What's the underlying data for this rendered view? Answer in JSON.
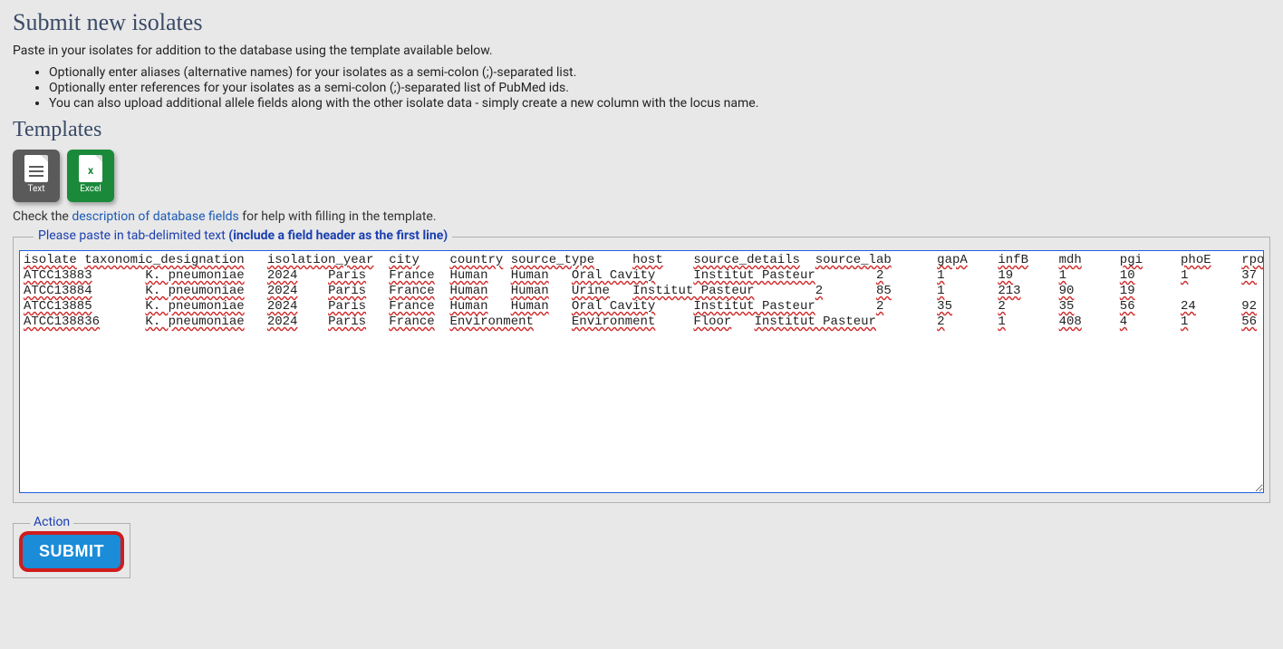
{
  "header": {
    "title": "Submit new isolates",
    "intro": "Paste in your isolates for addition to the database using the template available below.",
    "instructions": [
      "Optionally enter aliases (alternative names) for your isolates as a semi-colon (;)-separated list.",
      "Optionally enter references for your isolates as a semi-colon (;)-separated list of PubMed ids.",
      "You can also upload additional allele fields along with the other isolate data - simply create a new column with the locus name."
    ]
  },
  "templates": {
    "title": "Templates",
    "text_label": "Text",
    "excel_label": "Excel",
    "check_prefix": "Check the ",
    "check_link": "description of database fields",
    "check_suffix": " for help with filling in the template."
  },
  "paste_box": {
    "legend_plain": "Please paste in tab-delimited text ",
    "legend_bold": "(include a field header as the first line)",
    "value": "isolate\ttaxonomic_designation\tisolation_year\tcity\tcountry\tsource_type\thost\tsource_details\tsource_lab\tgapA\tinfB\tmdh\tpgi\tphoE\trpoB\ttonB\nATCC13883\tK. pneumoniae\t2024\tParis\tFrance\tHuman\tHuman\tOral Cavity\tInstitut Pasteur\t2\t1\t19\t1\t10\t1\t37\nATCC13884\tK. pneumoniae\t2024\tParis\tFrance\tHuman\tHuman\tUrine\tInstitut Pasteur\t2\t85\t1\t213\t90\t19\nATCC13885\tK. pneumoniae\t2024\tParis\tFrance\tHuman\tHuman\tOral Cavity\tInstitut Pasteur\t2\t35\t2\t35\t56\t24\t92\nATCC138836\tK. pneumoniae\t2024\tParis\tFrance\tEnvironment\tEnvironment\tFloor\tInstitut Pasteur\t2\t1\t408\t4\t1\t56"
  },
  "action": {
    "legend": "Action",
    "submit_label": "SUBMIT"
  }
}
